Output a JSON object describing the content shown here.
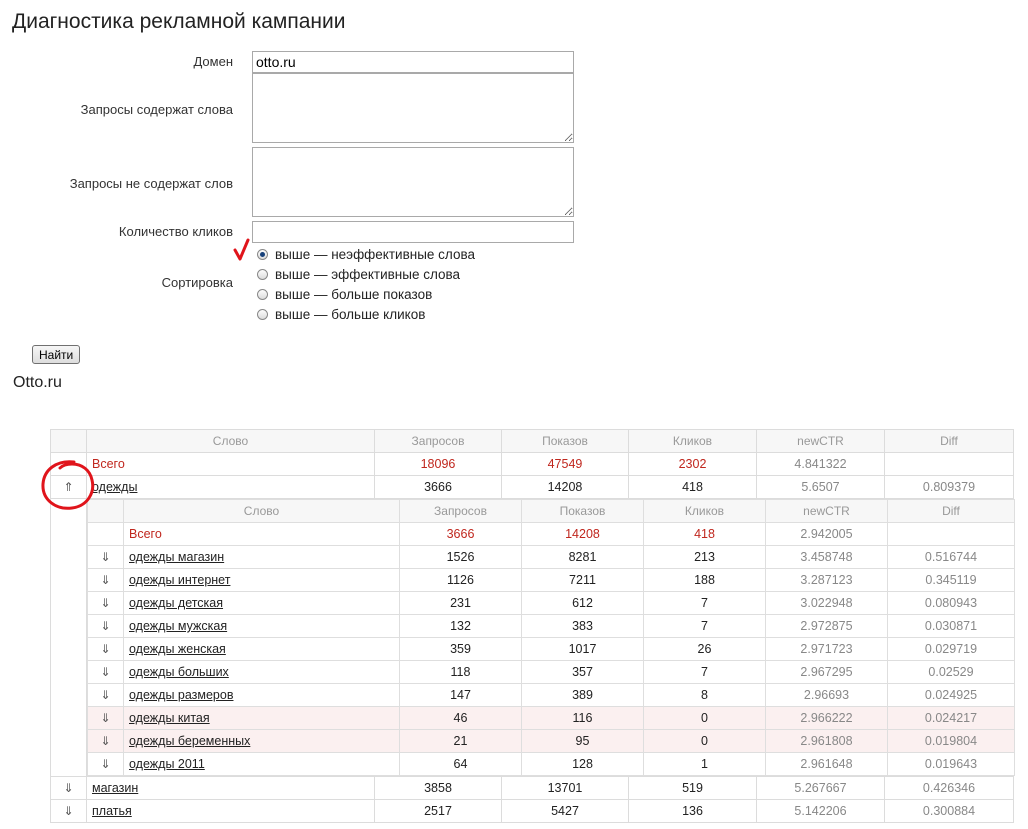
{
  "page": {
    "title": "Диагностика рекламной кампании"
  },
  "form": {
    "domain_label": "Домен",
    "domain_value": "otto.ru",
    "contains_label": "Запросы содержат слова",
    "not_contains_label": "Запросы не содержат слов",
    "clicks_label": "Количество кликов",
    "sort_label": "Сортировка",
    "sort_options": [
      {
        "label": "выше — неэффективные слова",
        "selected": true
      },
      {
        "label": "выше — эффективные слова",
        "selected": false
      },
      {
        "label": "выше — больше показов",
        "selected": false
      },
      {
        "label": "выше — больше кликов",
        "selected": false
      }
    ],
    "submit_label": "Найти"
  },
  "result_site": "Otto.ru",
  "table": {
    "headers": [
      "Слово",
      "Запросов",
      "Показов",
      "Кликов",
      "newCTR",
      "Diff"
    ],
    "total": {
      "word": "Всего",
      "requests": "18096",
      "shows": "47549",
      "clicks": "2302",
      "ctr": "4.841322",
      "diff": ""
    },
    "expanded_row": {
      "arrow": "⇑",
      "word": "одежды",
      "requests": "3666",
      "shows": "14208",
      "clicks": "418",
      "ctr": "5.6507",
      "diff": "0.809379"
    },
    "nested": {
      "total": {
        "word": "Всего",
        "requests": "3666",
        "shows": "14208",
        "clicks": "418",
        "ctr": "2.942005",
        "diff": ""
      },
      "rows": [
        {
          "arrow": "⇓",
          "word": "одежды магазин",
          "requests": "1526",
          "shows": "8281",
          "clicks": "213",
          "ctr": "3.458748",
          "diff": "0.516744",
          "highlight": false
        },
        {
          "arrow": "⇓",
          "word": "одежды интернет",
          "requests": "1126",
          "shows": "7211",
          "clicks": "188",
          "ctr": "3.287123",
          "diff": "0.345119",
          "highlight": false
        },
        {
          "arrow": "⇓",
          "word": "одежды детская",
          "requests": "231",
          "shows": "612",
          "clicks": "7",
          "ctr": "3.022948",
          "diff": "0.080943",
          "highlight": false
        },
        {
          "arrow": "⇓",
          "word": "одежды мужская",
          "requests": "132",
          "shows": "383",
          "clicks": "7",
          "ctr": "2.972875",
          "diff": "0.030871",
          "highlight": false
        },
        {
          "arrow": "⇓",
          "word": "одежды женская",
          "requests": "359",
          "shows": "1017",
          "clicks": "26",
          "ctr": "2.971723",
          "diff": "0.029719",
          "highlight": false
        },
        {
          "arrow": "⇓",
          "word": "одежды больших",
          "requests": "118",
          "shows": "357",
          "clicks": "7",
          "ctr": "2.967295",
          "diff": "0.02529",
          "highlight": false
        },
        {
          "arrow": "⇓",
          "word": "одежды размеров",
          "requests": "147",
          "shows": "389",
          "clicks": "8",
          "ctr": "2.96693",
          "diff": "0.024925",
          "highlight": false
        },
        {
          "arrow": "⇓",
          "word": "одежды китая",
          "requests": "46",
          "shows": "116",
          "clicks": "0",
          "ctr": "2.966222",
          "diff": "0.024217",
          "highlight": true
        },
        {
          "arrow": "⇓",
          "word": "одежды беременных",
          "requests": "21",
          "shows": "95",
          "clicks": "0",
          "ctr": "2.961808",
          "diff": "0.019804",
          "highlight": true
        },
        {
          "arrow": "⇓",
          "word": "одежды 2011",
          "requests": "64",
          "shows": "128",
          "clicks": "1",
          "ctr": "2.961648",
          "diff": "0.019643",
          "highlight": false
        }
      ]
    },
    "rows_after": [
      {
        "arrow": "⇓",
        "word": "магазин",
        "requests": "3858",
        "shows": "13701",
        "clicks": "519",
        "ctr": "5.267667",
        "diff": "0.426346"
      },
      {
        "arrow": "⇓",
        "word": "платья",
        "requests": "2517",
        "shows": "5427",
        "clicks": "136",
        "ctr": "5.142206",
        "diff": "0.300884"
      }
    ]
  },
  "colors": {
    "total_text": "#c0271e",
    "muted_text": "#888888",
    "annotation": "#e0141b",
    "highlight_row": "#fbf0f0"
  }
}
